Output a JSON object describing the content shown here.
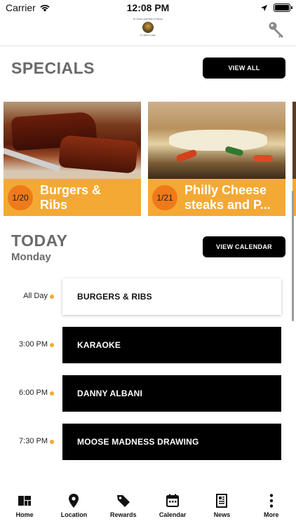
{
  "status_bar": {
    "carrier": "Carrier",
    "time": "12:08 PM"
  },
  "header": {
    "logo_line1": "St. Cloud Loyal Order of Moose",
    "logo_line2": "Ft. Myers Lodge"
  },
  "specials": {
    "title": "SPECIALS",
    "view_all_label": "VIEW ALL",
    "cards": [
      {
        "date": "1/20",
        "title_line1": "Burgers &",
        "title_line2": "Ribs"
      },
      {
        "date": "1/21",
        "title_line1": "Philly Cheese",
        "title_line2": "steaks and P..."
      }
    ]
  },
  "today": {
    "title": "TODAY",
    "day": "Monday",
    "view_calendar_label": "VIEW CALENDAR",
    "events": [
      {
        "time": "All Day",
        "name": "BURGERS & RIBS"
      },
      {
        "time": "3:00 PM",
        "name": "KARAOKE"
      },
      {
        "time": "6:00 PM",
        "name": "DANNY ALBANI"
      },
      {
        "time": "7:30 PM",
        "name": "MOOSE MADNESS DRAWING"
      }
    ]
  },
  "tab_bar": {
    "tabs": [
      {
        "label": "Home",
        "icon": "home-grid-icon"
      },
      {
        "label": "Location",
        "icon": "location-pin-icon"
      },
      {
        "label": "Rewards",
        "icon": "tag-icon"
      },
      {
        "label": "Calendar",
        "icon": "calendar-icon"
      },
      {
        "label": "News",
        "icon": "newspaper-icon"
      },
      {
        "label": "More",
        "icon": "more-dots-icon"
      }
    ]
  },
  "colors": {
    "accent": "#f4a935",
    "badge": "#ee7a1c",
    "dark": "#000000",
    "section_gray": "#6a6a6a"
  }
}
